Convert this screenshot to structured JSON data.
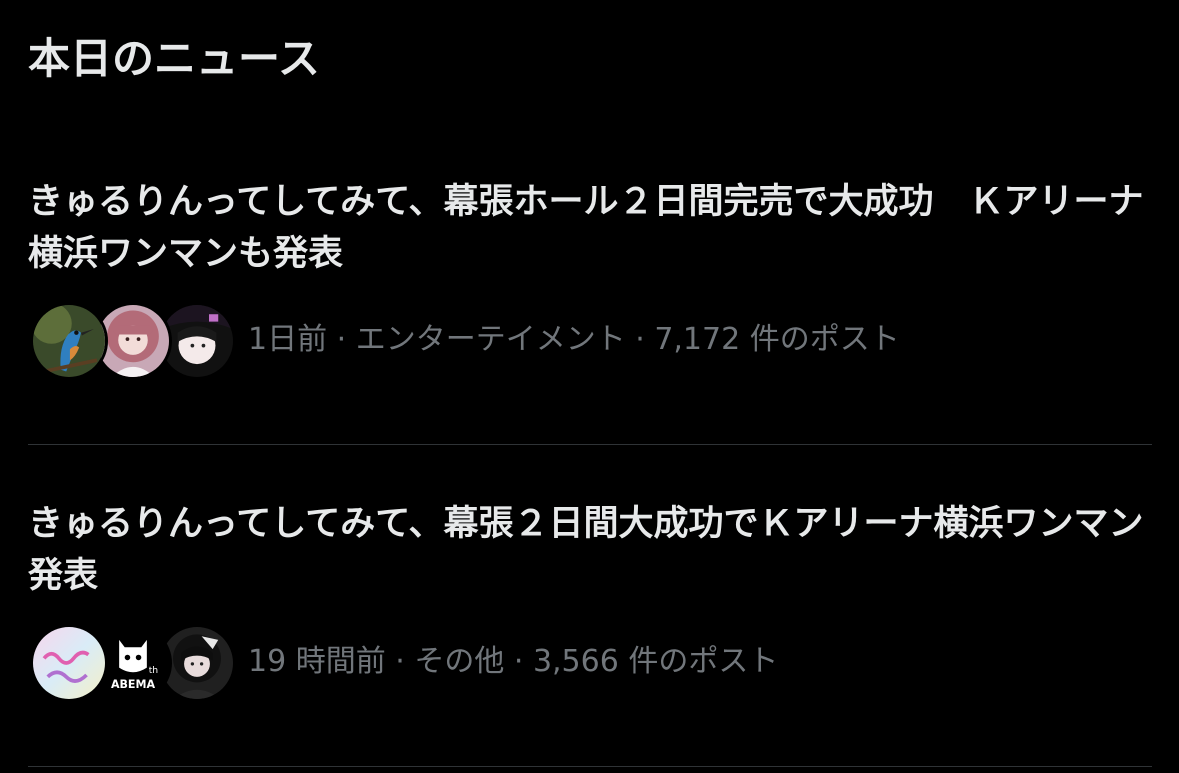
{
  "section": {
    "title": "本日のニュース"
  },
  "news": [
    {
      "headline": "きゅるりんってしてみて、幕張ホール２日間完売で大成功　Ｋアリーナ横浜ワンマンも発表",
      "time": "1日前",
      "category": "エンターテイメント",
      "posts": "7,172 件のポスト",
      "separator": " · ",
      "avatars": [
        "kingfisher-avatar",
        "pink-hair-avatar",
        "peace-sign-avatar"
      ]
    },
    {
      "headline": "きゅるりんってしてみて、幕張２日間大成功でＫアリーナ横浜ワンマン発表",
      "time": "19 時間前",
      "category": "その他",
      "posts": "3,566 件のポスト",
      "separator": " · ",
      "avatars": [
        "kyururin-logo-avatar",
        "abema-logo-avatar",
        "dark-hair-avatar"
      ],
      "logo_text": "ABEMA",
      "logo_sup": "th"
    }
  ],
  "colors": {
    "background": "#000000",
    "text": "#e7e9ea",
    "muted": "#71767b",
    "divider": "#2f3336"
  }
}
